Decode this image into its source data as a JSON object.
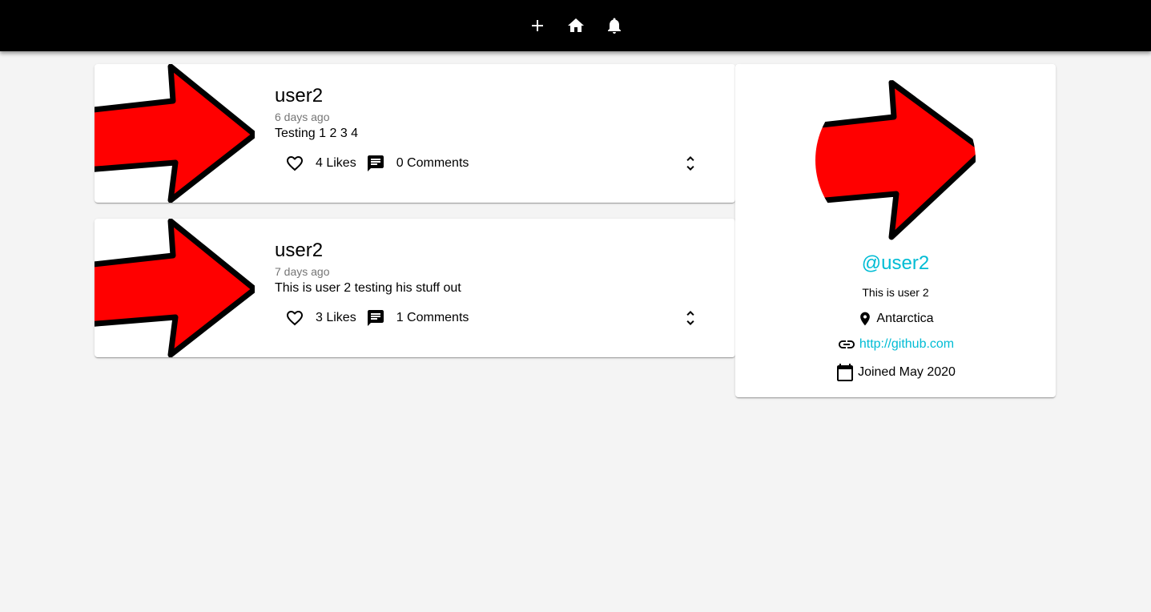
{
  "navbar": {
    "icons": [
      "add-icon",
      "home-icon",
      "notifications-icon"
    ]
  },
  "posts": [
    {
      "user": "user2",
      "date": "6 days ago",
      "body": "Testing 1 2 3 4",
      "likes": "4 Likes",
      "comments": "0 Comments"
    },
    {
      "user": "user2",
      "date": "7 days ago",
      "body": "This is user 2 testing his stuff out",
      "likes": "3 Likes",
      "comments": "1 Comments"
    }
  ],
  "profile": {
    "handle": "@user2",
    "bio": "This is user 2",
    "location": "Antarctica",
    "website": "http://github.com",
    "joined": "Joined May 2020"
  },
  "colors": {
    "appbar": "#000000",
    "background": "#f4f4f4",
    "accent": "#00bcd4",
    "arrow_fill": "#ff0000"
  }
}
